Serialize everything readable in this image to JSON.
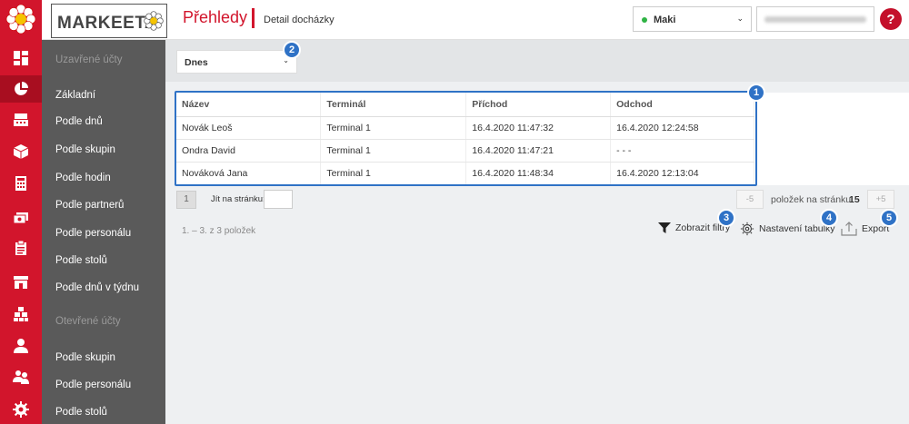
{
  "brand": {
    "name": "MARKEETA"
  },
  "header": {
    "title": "Přehledy",
    "subtitle": "Detail docházky"
  },
  "user": {
    "name": "Maki"
  },
  "help": {
    "label": "?"
  },
  "rail_icons": [
    "dashboard-icon",
    "reports-pie-icon",
    "register-icon",
    "box-icon",
    "calculator-icon",
    "money-icon",
    "clipboard-icon",
    "store-icon",
    "stock-icon",
    "user-icon",
    "users-icon",
    "settings-icon"
  ],
  "menu": {
    "section_closed": "Uzavřené účty",
    "closed_items": [
      "Základní",
      "Podle dnů",
      "Podle skupin",
      "Podle hodin",
      "Podle partnerů",
      "Podle personálu",
      "Podle stolů",
      "Podle dnů v týdnu"
    ],
    "section_open": "Otevřené účty",
    "open_items": [
      "Podle skupin",
      "Podle personálu",
      "Podle stolů"
    ]
  },
  "filter": {
    "date_value": "Dnes"
  },
  "table": {
    "columns": [
      "Název",
      "Terminál",
      "Příchod",
      "Odchod"
    ],
    "rows": [
      [
        "Novák Leoš",
        "Terminal 1",
        "16.4.2020 11:47:32",
        "16.4.2020 12:24:58"
      ],
      [
        "Ondra David",
        "Terminal 1",
        "16.4.2020 11:47:21",
        "- - -"
      ],
      [
        "Nováková Jana",
        "Terminal 1",
        "16.4.2020 11:48:34",
        "16.4.2020 12:13:04"
      ]
    ]
  },
  "pager": {
    "page": "1",
    "goto_label": "Jít na stránku:",
    "minus": "-5",
    "per_page_label": "položek na stránku",
    "per_page_value": "15",
    "plus": "+5",
    "count": "1. – 3. z 3 položek"
  },
  "actions": {
    "filters": "Zobrazit filtry",
    "table_settings": "Nastavení tabulky",
    "export": "Export"
  },
  "badges": [
    "1",
    "2",
    "3",
    "4",
    "5"
  ],
  "colors": {
    "brand_red": "#d2152c",
    "sidebar_gray": "#5a5a5a",
    "highlight_blue": "#2f72c6",
    "online_green": "#2fb344"
  }
}
